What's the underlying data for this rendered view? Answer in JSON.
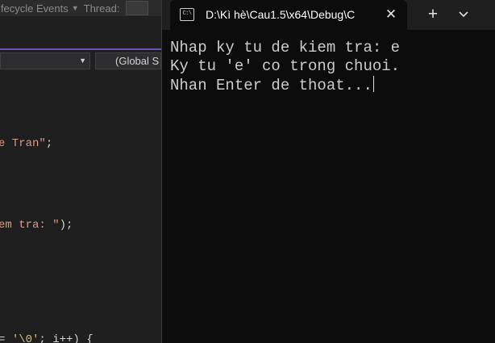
{
  "vs": {
    "toolbar": {
      "partial_text": "ifecycle Events",
      "thread_label": "Thread:"
    },
    "navbar": {
      "right_scope": "(Global S"
    },
    "code_lines": [
      {
        "string": "e Tran\"",
        "punct": ";"
      },
      {
        "string": "em tra: \"",
        "punct": ");"
      },
      {
        "pre": "= ",
        "esc": "'\\0'",
        "post": "; i++) {"
      }
    ]
  },
  "terminal": {
    "tab_title": "D:\\Kì hè\\Cau1.5\\x64\\Debug\\C",
    "icon_glyph": "C:\\",
    "close_glyph": "✕",
    "new_tab_glyph": "+",
    "output_lines": [
      "Nhap ky tu de kiem tra: e",
      "Ky tu 'e' co trong chuoi.",
      "Nhan Enter de thoat..."
    ]
  }
}
